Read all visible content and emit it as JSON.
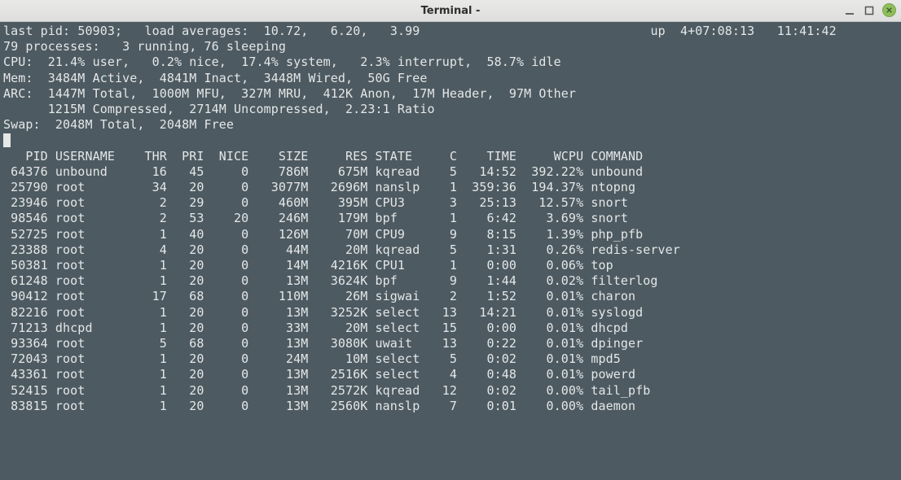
{
  "window": {
    "title": "Terminal -"
  },
  "header": {
    "last_pid_label": "last pid:",
    "last_pid": "50903",
    "load_avg_label": "load averages:",
    "load_avgs": "10.72,   6.20,   3.99",
    "uptime": "up  4+07:08:13",
    "clock": "11:41:42",
    "processes": "79 processes:   3 running, 76 sleeping",
    "cpu": "CPU:  21.4% user,   0.2% nice,  17.4% system,   2.3% interrupt,  58.7% idle",
    "mem": "Mem:  3484M Active,  4841M Inact,  3448M Wired,  50G Free",
    "arc": "ARC:  1447M Total,  1000M MFU,  327M MRU,  412K Anon,  17M Header,  97M Other",
    "arc2": "      1215M Compressed,  2714M Uncompressed,  2.23:1 Ratio",
    "swap": "Swap:  2048M Total,  2048M Free"
  },
  "columns": [
    "PID",
    "USERNAME",
    "THR",
    "PRI",
    "NICE",
    "SIZE",
    "RES",
    "STATE",
    "C",
    "TIME",
    "WCPU",
    "COMMAND"
  ],
  "rows": [
    {
      "pid": "64376",
      "user": "unbound",
      "thr": "16",
      "pri": "45",
      "nice": "0",
      "size": "786M",
      "res": "675M",
      "state": "kqread",
      "c": "5",
      "time": "14:52",
      "wcpu": "392.22%",
      "cmd": "unbound"
    },
    {
      "pid": "25790",
      "user": "root",
      "thr": "34",
      "pri": "20",
      "nice": "0",
      "size": "3077M",
      "res": "2696M",
      "state": "nanslp",
      "c": "1",
      "time": "359:36",
      "wcpu": "194.37%",
      "cmd": "ntopng"
    },
    {
      "pid": "23946",
      "user": "root",
      "thr": "2",
      "pri": "29",
      "nice": "0",
      "size": "460M",
      "res": "395M",
      "state": "CPU3",
      "c": "3",
      "time": "25:13",
      "wcpu": "12.57%",
      "cmd": "snort"
    },
    {
      "pid": "98546",
      "user": "root",
      "thr": "2",
      "pri": "53",
      "nice": "20",
      "size": "246M",
      "res": "179M",
      "state": "bpf",
      "c": "1",
      "time": "6:42",
      "wcpu": "3.69%",
      "cmd": "snort"
    },
    {
      "pid": "52725",
      "user": "root",
      "thr": "1",
      "pri": "40",
      "nice": "0",
      "size": "126M",
      "res": "70M",
      "state": "CPU9",
      "c": "9",
      "time": "8:15",
      "wcpu": "1.39%",
      "cmd": "php_pfb"
    },
    {
      "pid": "23388",
      "user": "root",
      "thr": "4",
      "pri": "20",
      "nice": "0",
      "size": "44M",
      "res": "20M",
      "state": "kqread",
      "c": "5",
      "time": "1:31",
      "wcpu": "0.26%",
      "cmd": "redis-server"
    },
    {
      "pid": "50381",
      "user": "root",
      "thr": "1",
      "pri": "20",
      "nice": "0",
      "size": "14M",
      "res": "4216K",
      "state": "CPU1",
      "c": "1",
      "time": "0:00",
      "wcpu": "0.06%",
      "cmd": "top"
    },
    {
      "pid": "61248",
      "user": "root",
      "thr": "1",
      "pri": "20",
      "nice": "0",
      "size": "13M",
      "res": "3624K",
      "state": "bpf",
      "c": "9",
      "time": "1:44",
      "wcpu": "0.02%",
      "cmd": "filterlog"
    },
    {
      "pid": "90412",
      "user": "root",
      "thr": "17",
      "pri": "68",
      "nice": "0",
      "size": "110M",
      "res": "26M",
      "state": "sigwai",
      "c": "2",
      "time": "1:52",
      "wcpu": "0.01%",
      "cmd": "charon"
    },
    {
      "pid": "82216",
      "user": "root",
      "thr": "1",
      "pri": "20",
      "nice": "0",
      "size": "13M",
      "res": "3252K",
      "state": "select",
      "c": "13",
      "time": "14:21",
      "wcpu": "0.01%",
      "cmd": "syslogd"
    },
    {
      "pid": "71213",
      "user": "dhcpd",
      "thr": "1",
      "pri": "20",
      "nice": "0",
      "size": "33M",
      "res": "20M",
      "state": "select",
      "c": "15",
      "time": "0:00",
      "wcpu": "0.01%",
      "cmd": "dhcpd"
    },
    {
      "pid": "93364",
      "user": "root",
      "thr": "5",
      "pri": "68",
      "nice": "0",
      "size": "13M",
      "res": "3080K",
      "state": "uwait",
      "c": "13",
      "time": "0:22",
      "wcpu": "0.01%",
      "cmd": "dpinger"
    },
    {
      "pid": "72043",
      "user": "root",
      "thr": "1",
      "pri": "20",
      "nice": "0",
      "size": "24M",
      "res": "10M",
      "state": "select",
      "c": "5",
      "time": "0:02",
      "wcpu": "0.01%",
      "cmd": "mpd5"
    },
    {
      "pid": "43361",
      "user": "root",
      "thr": "1",
      "pri": "20",
      "nice": "0",
      "size": "13M",
      "res": "2516K",
      "state": "select",
      "c": "4",
      "time": "0:48",
      "wcpu": "0.01%",
      "cmd": "powerd"
    },
    {
      "pid": "52415",
      "user": "root",
      "thr": "1",
      "pri": "20",
      "nice": "0",
      "size": "13M",
      "res": "2572K",
      "state": "kqread",
      "c": "12",
      "time": "0:02",
      "wcpu": "0.00%",
      "cmd": "tail_pfb"
    },
    {
      "pid": "83815",
      "user": "root",
      "thr": "1",
      "pri": "20",
      "nice": "0",
      "size": "13M",
      "res": "2560K",
      "state": "nanslp",
      "c": "7",
      "time": "0:01",
      "wcpu": "0.00%",
      "cmd": "daemon"
    }
  ]
}
